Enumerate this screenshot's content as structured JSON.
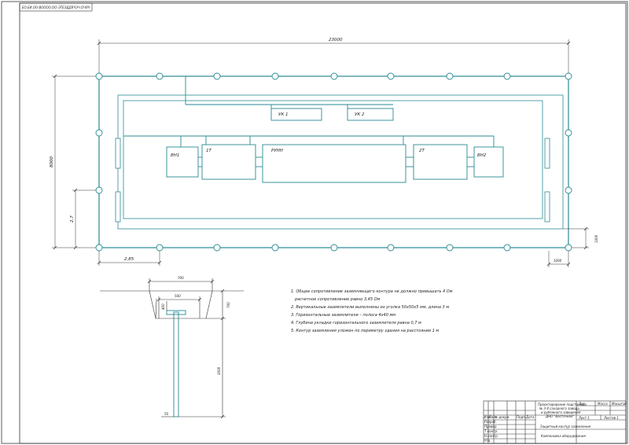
{
  "stamp": "ЕО.ЕИ.ОО-ВОООО.ОО-ЭТЕЭДДЯЧЭЧ.ОЧЯЧ",
  "dims": {
    "total_length": "23000",
    "height": "8000",
    "left_offset": "2,7",
    "bottom_left": "2,85",
    "right_gap_v": "1000",
    "right_gap_h": "1000"
  },
  "equipment": {
    "vn1": "ВН1",
    "t1": "1Т",
    "rp": "РУНН",
    "t2": "2Т",
    "vn2": "ВН2",
    "uk1": "УК 1",
    "uk2": "УК 2"
  },
  "section": {
    "top_width": "700",
    "inner_width": "500",
    "depth": "700",
    "small_dim": "400",
    "rod_length": "3000",
    "rod_dim": "50"
  },
  "notes": [
    "1. Общее сопротивление заземляющего контура не должно превышать 4 Ом",
    "расчетное сопротивление равно 3,45 Ом",
    "2. Вертикальные заземлители выполнены из уголка 50х50х5 мм, длина 3 м",
    "3. Горизонтальные заземлители – полоса 4х40 мм",
    "4. Глубина укладки горизонтального заземлителя равна 0,7 м",
    "5. Контур заземления уложен по периметру здания на расстоянии 1 м"
  ],
  "title_block": {
    "title1": "Проектирование подстанции",
    "title2": "№ 3-4 сахарного завода",
    "title3": "и рубежного заведения",
    "title4": "ДНО \"Восточное\"",
    "drawing": "Защитный контур заземления",
    "subtitle": "Компоновка оборудования",
    "col_lit": "Лит",
    "col_mass": "Масса",
    "col_scale": "Масштаб",
    "sheet": "Лист 1",
    "sheets": "Листов 1",
    "rows": [
      "Разраб.",
      "Провер.",
      "Т.контр.",
      "",
      "Н.контр.",
      "Утв."
    ],
    "cols": [
      "Изм",
      "Лист",
      "№ докум.",
      "Подп.",
      "Дата"
    ]
  }
}
